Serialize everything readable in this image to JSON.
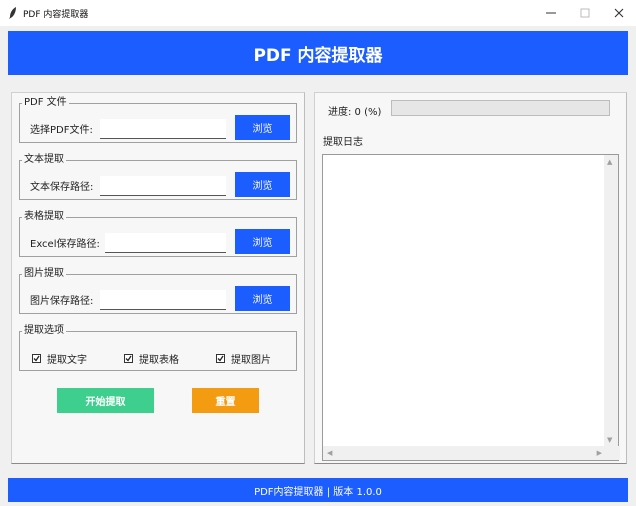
{
  "window": {
    "title": "PDF 内容提取器"
  },
  "banner": {
    "title": "PDF 内容提取器"
  },
  "groups": {
    "pdf": {
      "legend": "PDF 文件",
      "label": "选择PDF文件:",
      "value": "",
      "button": "浏览"
    },
    "text": {
      "legend": "文本提取",
      "label": "文本保存路径:",
      "value": "",
      "button": "浏览"
    },
    "table": {
      "legend": "表格提取",
      "label": "Excel保存路径:",
      "value": "",
      "button": "浏览"
    },
    "image": {
      "legend": "图片提取",
      "label": "图片保存路径:",
      "value": "",
      "button": "浏览"
    }
  },
  "options": {
    "legend": "提取选项",
    "items": [
      {
        "label": "提取文字",
        "checked": true
      },
      {
        "label": "提取表格",
        "checked": true
      },
      {
        "label": "提取图片",
        "checked": true
      }
    ]
  },
  "actions": {
    "start": {
      "label": "开始提取",
      "color": "#3ecf8e"
    },
    "reset": {
      "label": "重置",
      "color": "#f39c12"
    }
  },
  "progress": {
    "label": "进度: 0 (%)",
    "value": 0
  },
  "log": {
    "label": "提取日志",
    "content": ""
  },
  "footer": {
    "text": "PDF内容提取器 | 版本 1.0.0"
  },
  "colors": {
    "accent": "#1c5dff"
  }
}
